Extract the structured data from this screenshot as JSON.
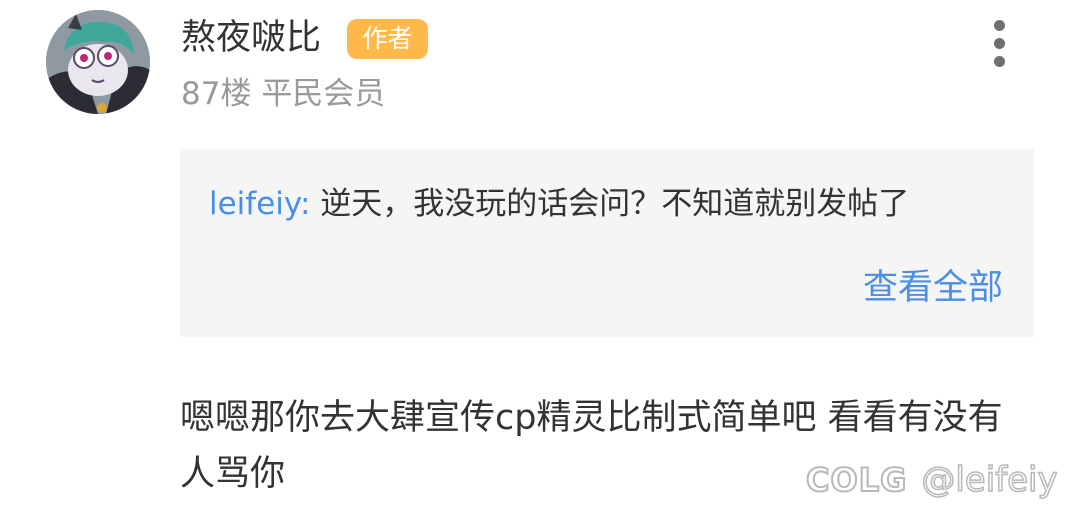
{
  "post": {
    "author": {
      "name": "熬夜啵比",
      "badge": "作者",
      "floor": "87楼",
      "level": "平民会员"
    },
    "more_icon": "more-vertical-icon",
    "quote": {
      "user": "leifeiy:",
      "text": " 逆天，我没玩的话会问？不知道就别发帖了",
      "view_all": "查看全部"
    },
    "body": "嗯嗯那你去大肆宣传cp精灵比制式简单吧 看看有没有人骂你"
  },
  "watermark": {
    "logo": "COLG",
    "handle": "@leifeiy"
  },
  "colors": {
    "badge": "#ffb948",
    "link": "#4a8ee6",
    "text": "#333333",
    "muted": "#9a9a9a",
    "quote_bg": "#f5f5f5"
  }
}
